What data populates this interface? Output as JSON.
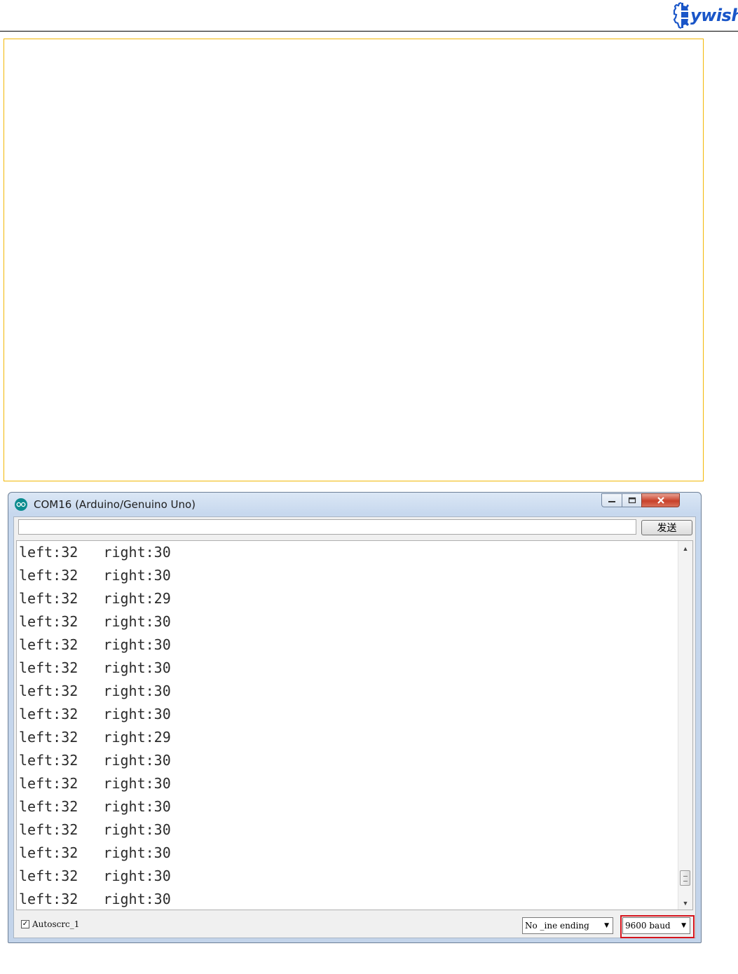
{
  "header": {
    "logo_text": "ywish",
    "logo_color": "#1a56c8"
  },
  "window": {
    "title": "COM16 (Arduino/Genuino Uno)",
    "send_input_value": "",
    "send_label": "发送",
    "output_lines": [
      "left:32   right:30",
      "left:32   right:30",
      "left:32   right:29",
      "left:32   right:30",
      "left:32   right:30",
      "left:32   right:30",
      "left:32   right:30",
      "left:32   right:30",
      "left:32   right:29",
      "left:32   right:30",
      "left:32   right:30",
      "left:32   right:30",
      "left:32   right:30",
      "left:32   right:30",
      "left:32   right:30",
      "left:32   right:30"
    ],
    "autoscroll_label": "Autoscrc_1",
    "autoscroll_checked": true,
    "line_ending": "No _ine ending",
    "baud": "9600 baud",
    "highlight_color": "#d4141c"
  }
}
